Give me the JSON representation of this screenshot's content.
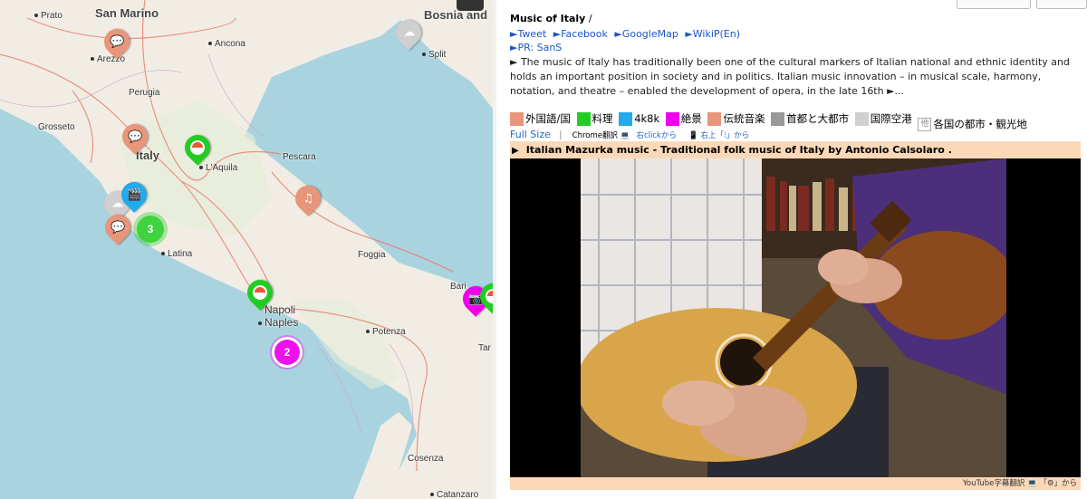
{
  "map": {
    "labels": {
      "prato": "Prato",
      "san_marino": "San Marino",
      "bosnia": "Bosnia and",
      "ancona": "Ancona",
      "arezzo": "Arezzo",
      "split": "Split",
      "perugia": "Perugia",
      "grosseto": "Grosseto",
      "italy": "Italy",
      "laquila": "L'Aquila",
      "pescara": "Pescara",
      "latina": "Latina",
      "foggia": "Foggia",
      "bari": "Bari",
      "napoli": "Napoli",
      "naples": "Naples",
      "potenza": "Potenza",
      "taranto": "Tar",
      "cosenza": "Cosenza",
      "catanzaro": "Catanzaro"
    },
    "clusters": {
      "rome_count": "3",
      "naples_count": "2"
    }
  },
  "panel": {
    "title": "Music of Italy",
    "title_sep": "/",
    "links": [
      "►Tweet",
      "►Facebook",
      "►GoogleMap",
      "►WikiP(En)"
    ],
    "pr_link": "►PR: SanS",
    "description": "► The music of Italy has traditionally been one of the cultural markers of Italian national and ethnic identity and holds an important position in society and in politics. Italian music innovation – in musical scale, harmony, notation, and theatre – enabled the development of opera, in the late 16th ►...",
    "legend": [
      {
        "label": "外国語/国",
        "color": "#e8957a"
      },
      {
        "label": "料理",
        "color": "#22cc22"
      },
      {
        "label": "4k8k",
        "color": "#22aaee"
      },
      {
        "label": "絶景",
        "color": "#ee00ee"
      },
      {
        "label": "伝統音楽",
        "color": "#e8957a"
      },
      {
        "label": "首都と大都市",
        "color": "#999999"
      },
      {
        "label": "国際空港",
        "color": "#d0d0d0"
      },
      {
        "label": "各国の都市・観光地",
        "color": "#ffffff",
        "sw_text": "他"
      }
    ],
    "full_size": "Full Size",
    "separator": "|",
    "chrome_translate": "Chrome翻訳 💻",
    "right_click": "右clickから",
    "mobile_label": "📱 右上「⁝」から",
    "video_title": "Italian Mazurka music - Traditional folk music of Italy by Antonio Calsolaro .",
    "video_footer": "YouTube字幕翻訳 💻 「⚙」から"
  }
}
